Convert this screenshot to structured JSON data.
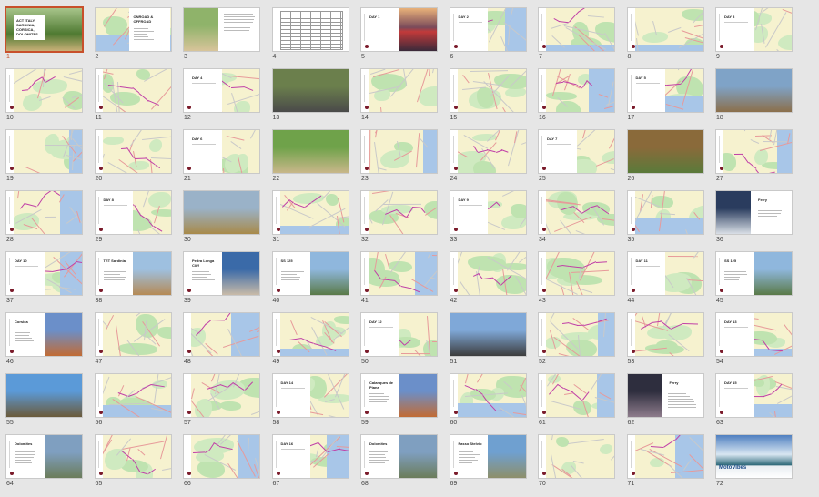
{
  "window": {
    "background": "#e6e6e6",
    "selected_color": "#c8502b"
  },
  "slides": [
    {
      "n": "1",
      "type": "cover",
      "title": "ACT ITALY,\nSARDINIA,\nCORSICA,\nDOLOMITES",
      "selected": true
    },
    {
      "n": "2",
      "type": "map_text",
      "title": "ONROAD &\nOFFROAD"
    },
    {
      "n": "3",
      "type": "photo_text",
      "photo": "road"
    },
    {
      "n": "4",
      "type": "table"
    },
    {
      "n": "5",
      "type": "day_photo",
      "title": "DAY 1",
      "photo": "night"
    },
    {
      "n": "6",
      "type": "day_map",
      "title": "DAY 2"
    },
    {
      "n": "7",
      "type": "map"
    },
    {
      "n": "8",
      "type": "map"
    },
    {
      "n": "9",
      "type": "day_map",
      "title": "DAY 3"
    },
    {
      "n": "10",
      "type": "map"
    },
    {
      "n": "11",
      "type": "map"
    },
    {
      "n": "12",
      "type": "day_map",
      "title": "DAY 4"
    },
    {
      "n": "13",
      "type": "photo",
      "photo": "bikes"
    },
    {
      "n": "14",
      "type": "map"
    },
    {
      "n": "15",
      "type": "map"
    },
    {
      "n": "16",
      "type": "map"
    },
    {
      "n": "17",
      "type": "day_map",
      "title": "DAY 5"
    },
    {
      "n": "18",
      "type": "photo",
      "photo": "farm"
    },
    {
      "n": "19",
      "type": "map"
    },
    {
      "n": "20",
      "type": "map"
    },
    {
      "n": "21",
      "type": "day_map",
      "title": "DAY 6"
    },
    {
      "n": "22",
      "type": "photo",
      "photo": "green"
    },
    {
      "n": "23",
      "type": "map"
    },
    {
      "n": "24",
      "type": "map"
    },
    {
      "n": "25",
      "type": "day_map",
      "title": "DAY 7"
    },
    {
      "n": "26",
      "type": "photo",
      "photo": "mud"
    },
    {
      "n": "27",
      "type": "map"
    },
    {
      "n": "28",
      "type": "map"
    },
    {
      "n": "29",
      "type": "day_map",
      "title": "DAY 8"
    },
    {
      "n": "30",
      "type": "photo",
      "photo": "field"
    },
    {
      "n": "31",
      "type": "map"
    },
    {
      "n": "32",
      "type": "map"
    },
    {
      "n": "33",
      "type": "day_map",
      "title": "DAY 9"
    },
    {
      "n": "34",
      "type": "map"
    },
    {
      "n": "35",
      "type": "map"
    },
    {
      "n": "36",
      "type": "photo_right",
      "title": "Ferry",
      "photo": "ferry"
    },
    {
      "n": "37",
      "type": "day_map",
      "title": "DAY 10"
    },
    {
      "n": "38",
      "type": "text_photo",
      "title": "TET Sardinia",
      "photo": "dirt"
    },
    {
      "n": "39",
      "type": "text_photo",
      "title": "Pedra Longa\nCliff",
      "photo": "rock"
    },
    {
      "n": "40",
      "type": "text_photo",
      "title": "SS 125",
      "photo": "mountain"
    },
    {
      "n": "41",
      "type": "map"
    },
    {
      "n": "42",
      "type": "map"
    },
    {
      "n": "43",
      "type": "map"
    },
    {
      "n": "44",
      "type": "day_map",
      "title": "DAY 11"
    },
    {
      "n": "45",
      "type": "text_photo",
      "title": "SS 125",
      "photo": "mountain"
    },
    {
      "n": "46",
      "type": "text_photo",
      "title": "Corsica",
      "photo": "canyon"
    },
    {
      "n": "47",
      "type": "map"
    },
    {
      "n": "48",
      "type": "map_sea"
    },
    {
      "n": "49",
      "type": "map_sea"
    },
    {
      "n": "50",
      "type": "day_map",
      "title": "DAY 12"
    },
    {
      "n": "51",
      "type": "photo",
      "photo": "overlook"
    },
    {
      "n": "52",
      "type": "map"
    },
    {
      "n": "53",
      "type": "map"
    },
    {
      "n": "54",
      "type": "day_map",
      "title": "DAY 13"
    },
    {
      "n": "55",
      "type": "photo",
      "photo": "coast"
    },
    {
      "n": "56",
      "type": "map_sea"
    },
    {
      "n": "57",
      "type": "map"
    },
    {
      "n": "58",
      "type": "day_map",
      "title": "DAY 14"
    },
    {
      "n": "59",
      "type": "text_photo",
      "title": "Calanques de\nPiana",
      "photo": "canyon"
    },
    {
      "n": "60",
      "type": "map_sea"
    },
    {
      "n": "61",
      "type": "map"
    },
    {
      "n": "62",
      "type": "photo_text",
      "title": "Ferry",
      "photo": "cabin"
    },
    {
      "n": "63",
      "type": "day_map",
      "title": "DAY 15"
    },
    {
      "n": "64",
      "type": "text_photo",
      "title": "Dolomites",
      "photo": "peaks"
    },
    {
      "n": "65",
      "type": "map"
    },
    {
      "n": "66",
      "type": "map"
    },
    {
      "n": "67",
      "type": "day_map",
      "title": "DAY 16"
    },
    {
      "n": "68",
      "type": "text_photo",
      "title": "Dolomites",
      "photo": "peaks"
    },
    {
      "n": "69",
      "type": "text_photo",
      "title": "Passo Stelvio",
      "photo": "stelvio"
    },
    {
      "n": "70",
      "type": "map"
    },
    {
      "n": "71",
      "type": "map"
    },
    {
      "n": "72",
      "type": "end",
      "title": "MotoVibes",
      "photo": "lake"
    }
  ],
  "photo_palette": {
    "road": [
      "#8fb36a",
      "#d8c49a"
    ],
    "night": [
      "#d9a06a",
      "#3b2a4a"
    ],
    "bikes": [
      "#6b7f4c",
      "#4a4a4a"
    ],
    "farm": [
      "#7fa3c7",
      "#8b6f4b"
    ],
    "green": [
      "#6fa24a",
      "#c9b78a"
    ],
    "mud": [
      "#8a6a3a",
      "#5a7a3a"
    ],
    "field": [
      "#9ab2c8",
      "#a88a4a"
    ],
    "ferry": [
      "#2a3c5e",
      "#d9dfe6"
    ],
    "dirt": [
      "#9ec0e0",
      "#b58a55"
    ],
    "rock": [
      "#3a6aa8",
      "#c9bba8"
    ],
    "mountain": [
      "#8fb7dd",
      "#5a7a48"
    ],
    "canyon": [
      "#6b8fc9",
      "#c26b34"
    ],
    "overlook": [
      "#7fa8d8",
      "#3c3c3c"
    ],
    "coast": [
      "#5b9ad8",
      "#6b5a3a"
    ],
    "cabin": [
      "#2e2e3e",
      "#8e7c8c"
    ],
    "peaks": [
      "#7f9fc0",
      "#6b7c5a"
    ],
    "stelvio": [
      "#6fa0d0",
      "#8d8f6a"
    ],
    "lake": [
      "#5f8fc8",
      "#3c7a8c"
    ]
  }
}
